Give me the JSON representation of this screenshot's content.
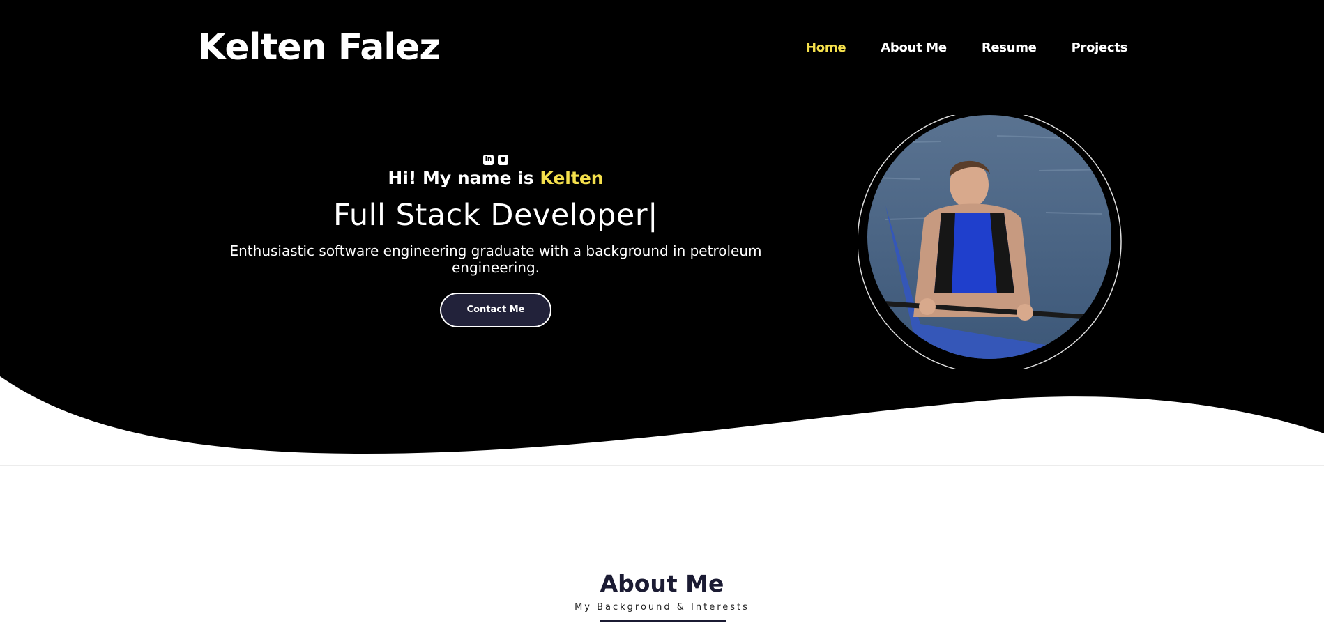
{
  "colors": {
    "accent": "#f5e04c",
    "hero_bg": "#000000",
    "button_bg": "#22223a",
    "heading": "#1b1b33"
  },
  "header": {
    "brand": "Kelten Falez",
    "nav": [
      {
        "label": "Home",
        "active": true
      },
      {
        "label": "About Me",
        "active": false
      },
      {
        "label": "Resume",
        "active": false
      },
      {
        "label": "Projects",
        "active": false
      }
    ]
  },
  "hero": {
    "socials": [
      {
        "icon": "linkedin-icon"
      },
      {
        "icon": "github-icon"
      }
    ],
    "greeting_prefix": "Hi! My name is",
    "greeting_name": "Kelten",
    "role": "Full Stack Developer",
    "cursor": "|",
    "tagline": "Enthusiastic software engineering graduate with a background in petroleum engineering.",
    "contact_label": "Contact Me",
    "portrait": "profile-photo-kayak"
  },
  "about": {
    "title": "About Me",
    "subtitle": "My Background & Interests"
  }
}
